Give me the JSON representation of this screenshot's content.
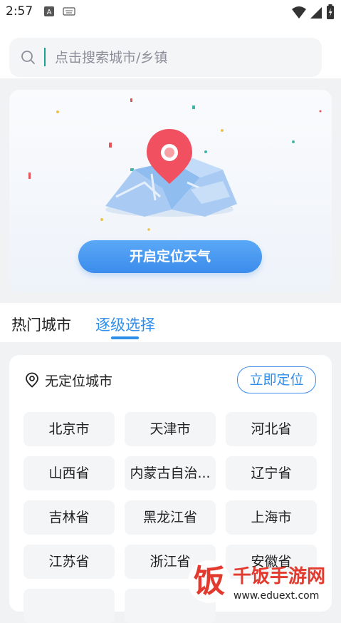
{
  "status": {
    "time": "2:57",
    "icons": [
      "a-icon",
      "keyboard-icon",
      "wifi-icon",
      "signal-icon",
      "battery-icon"
    ]
  },
  "search": {
    "placeholder": "点击搜索城市/乡镇",
    "icon": "search-icon"
  },
  "banner": {
    "button_label": "开启定位天气"
  },
  "tabs": [
    {
      "label": "热门城市",
      "active": false
    },
    {
      "label": "逐级选择",
      "active": true
    }
  ],
  "panel": {
    "no_location_text": "无定位城市",
    "locate_now_label": "立即定位",
    "cities": [
      "北京市",
      "天津市",
      "河北省",
      "山西省",
      "内蒙古自治...",
      "辽宁省",
      "吉林省",
      "黑龙江省",
      "上海市",
      "江苏省",
      "浙江省",
      "安徽省"
    ]
  },
  "watermark": {
    "text": "千饭手游网",
    "url": "www.eduext.com"
  },
  "colors": {
    "accent": "#2f8eea",
    "button": "#3b8cec",
    "pin": "#f0505f"
  }
}
